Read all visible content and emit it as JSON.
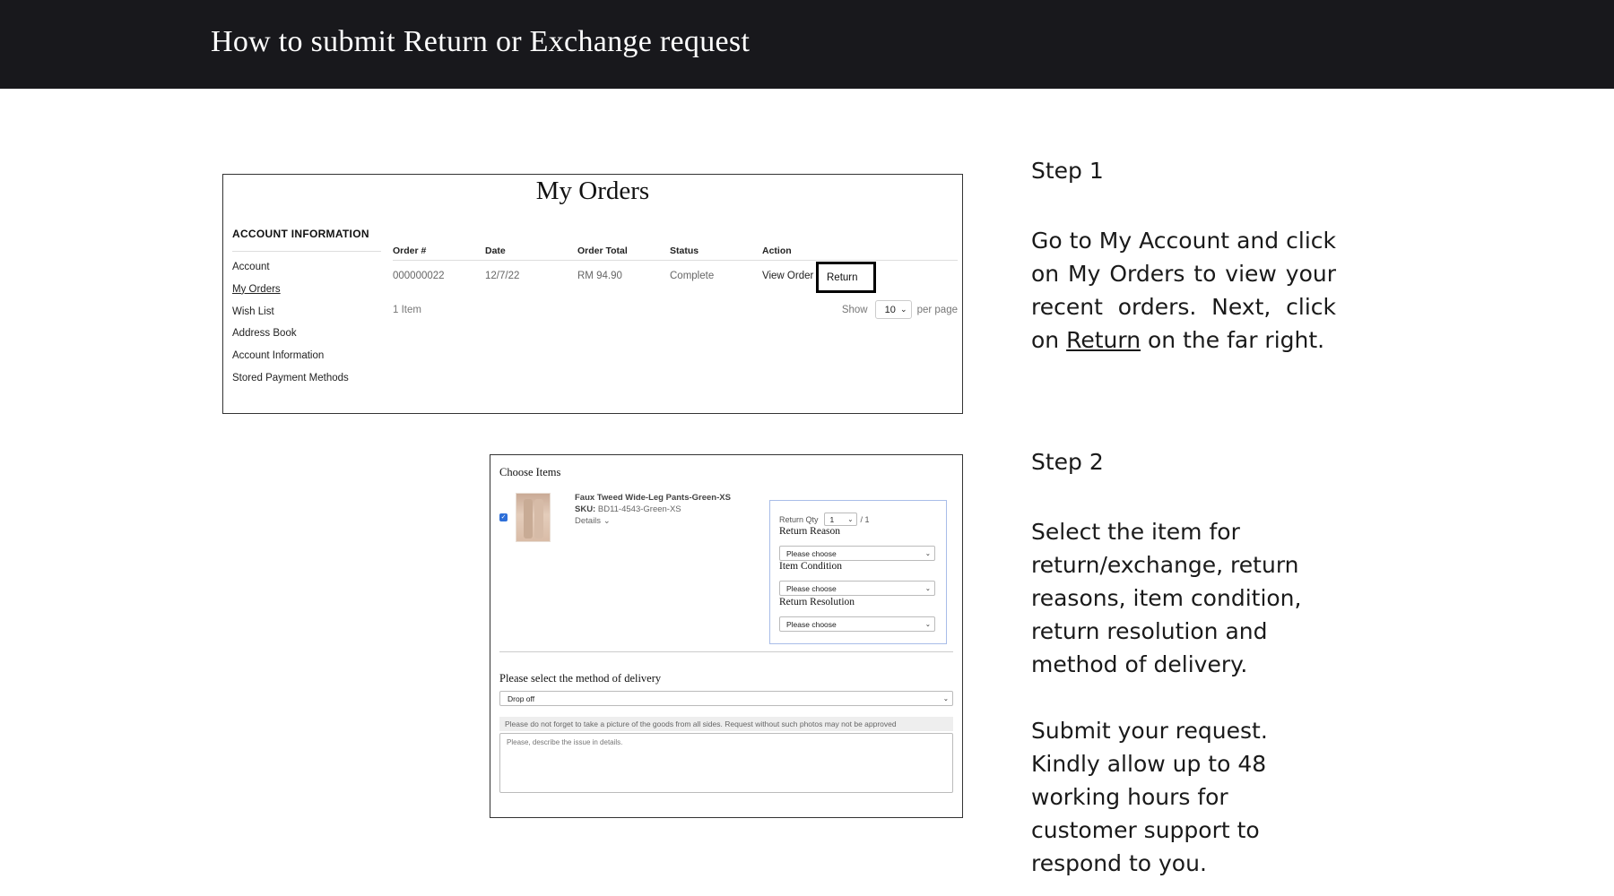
{
  "header": {
    "title": "How to submit Return or Exchange request"
  },
  "screenshot1": {
    "page_title": "My Orders",
    "account_heading": "ACCOUNT INFORMATION",
    "nav_items": [
      "Account",
      "My Orders",
      "Wish List",
      "Address Book",
      "Account Information",
      "Stored Payment Methods"
    ],
    "active_nav": "My Orders",
    "columns": [
      "Order #",
      "Date",
      "Order Total",
      "Status",
      "Action"
    ],
    "order_row": {
      "order_no": "000000022",
      "date": "12/7/22",
      "total": "RM 94.90",
      "status": "Complete",
      "view_order": "View Order",
      "return": "Return"
    },
    "items_count": "1 Item",
    "pager": {
      "show_label": "Show",
      "per_page_value": "10",
      "per_page_label": "per page"
    }
  },
  "screenshot2": {
    "choose_items_title": "Choose Items",
    "item": {
      "checked": true,
      "name": "Faux Tweed Wide-Leg Pants-Green-XS",
      "sku_label": "SKU:",
      "sku_value": "BD11-4543-Green-XS",
      "details_label": "Details"
    },
    "return_qty_label": "Return Qty",
    "return_qty_value": "1",
    "return_qty_max": "/ 1",
    "return_reason_label": "Return Reason",
    "item_condition_label": "Item Condition",
    "return_resolution_label": "Return Resolution",
    "select_placeholder": "Please choose",
    "delivery_label": "Please select the method of delivery",
    "delivery_value": "Drop off",
    "photo_note": "Please do not forget to take a picture of the goods from all sides. Request without such photos may not be approved",
    "issue_placeholder": "Please, describe the issue in details."
  },
  "instructions": {
    "step1_title": "Step 1",
    "step1_text_before": "Go to My Account and click on My Orders to view your recent orders. Next, click on ",
    "step1_link": "Return",
    "step1_text_after": " on the far right.",
    "step2_title": "Step 2",
    "step2_text": "Select the item for return/exchange, return reasons, item condition, return resolution and method of delivery.",
    "step3_text": "Submit your request. Kindly allow up to 48 working hours for customer support to respond to you."
  }
}
